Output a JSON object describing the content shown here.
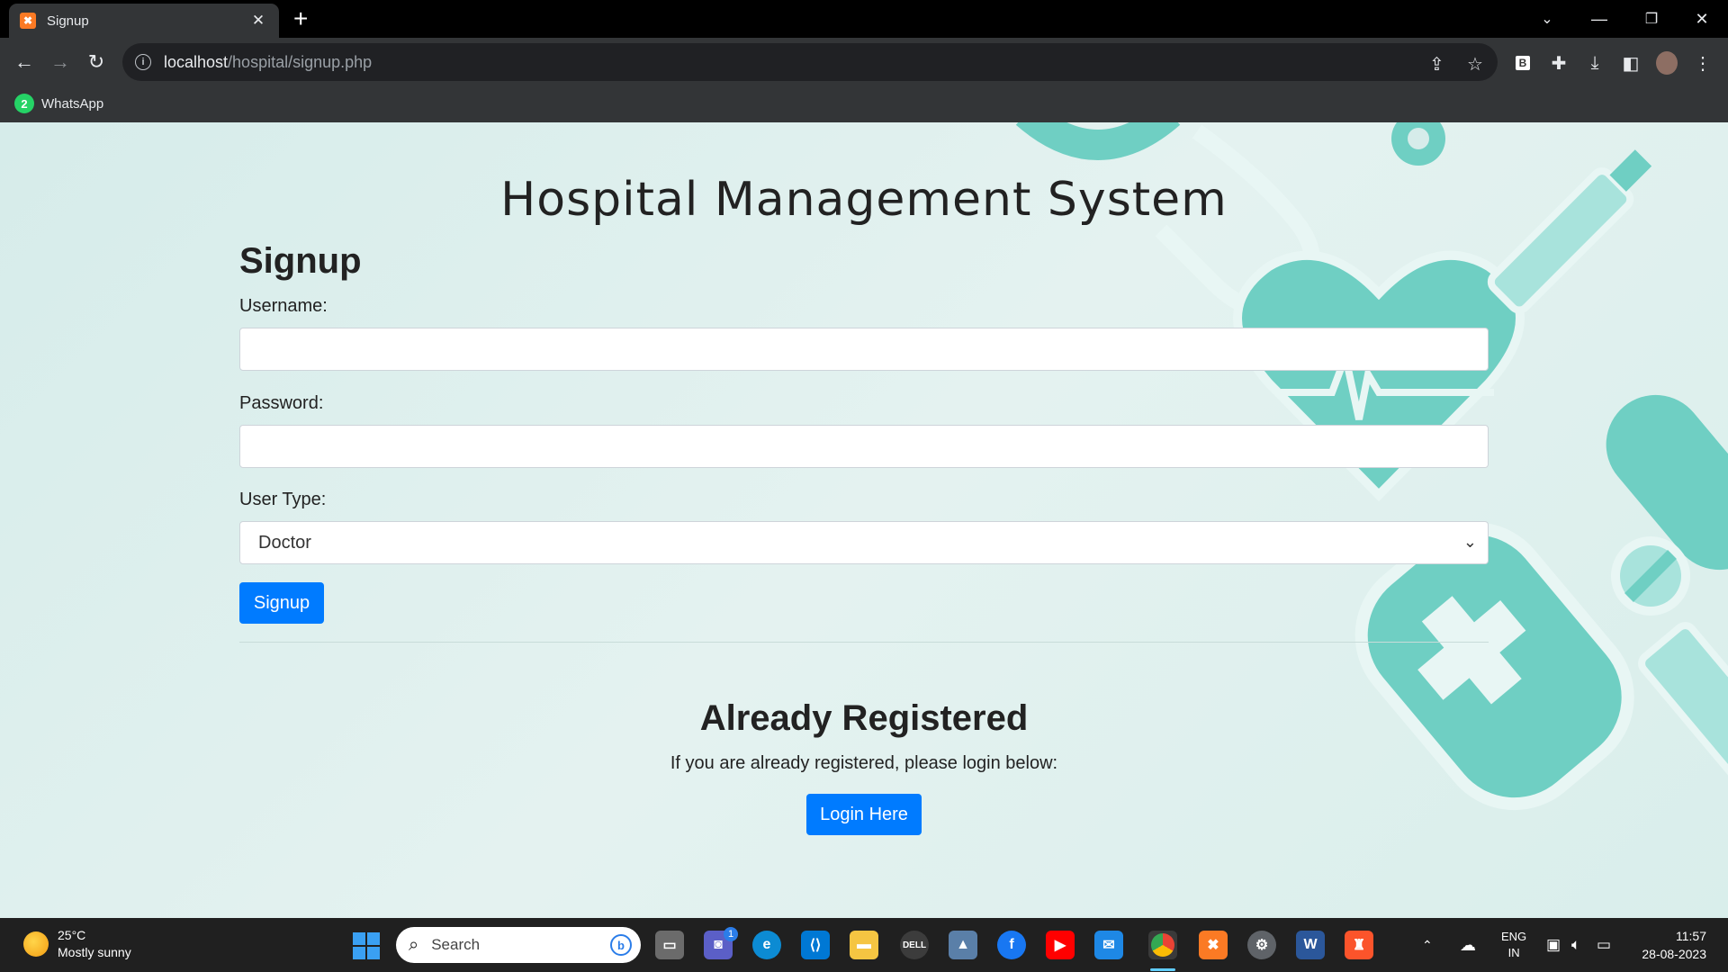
{
  "browser": {
    "tab_title": "Signup",
    "url_host": "localhost",
    "url_path": "/hospital/signup.php",
    "bookmark_whatsapp": "WhatsApp",
    "bookmark_badge": "2"
  },
  "page": {
    "app_title": "Hospital Management System",
    "heading": "Signup",
    "username_label": "Username:",
    "username_value": "",
    "password_label": "Password:",
    "password_value": "",
    "user_type_label": "User Type:",
    "user_type_selected": "Doctor",
    "signup_button": "Signup",
    "already_heading": "Already Registered",
    "already_text": "If you are already registered, please login below:",
    "login_button": "Login Here"
  },
  "taskbar": {
    "temperature": "25°C",
    "weather": "Mostly sunny",
    "search_placeholder": "Search",
    "lang_top": "ENG",
    "lang_bottom": "IN",
    "time": "11:57",
    "date": "28-08-2023",
    "teams_badge": "1"
  },
  "colors": {
    "primary_button": "#007bff",
    "page_bg": "#d6ecea",
    "deco_teal": "#6fcfc3"
  }
}
